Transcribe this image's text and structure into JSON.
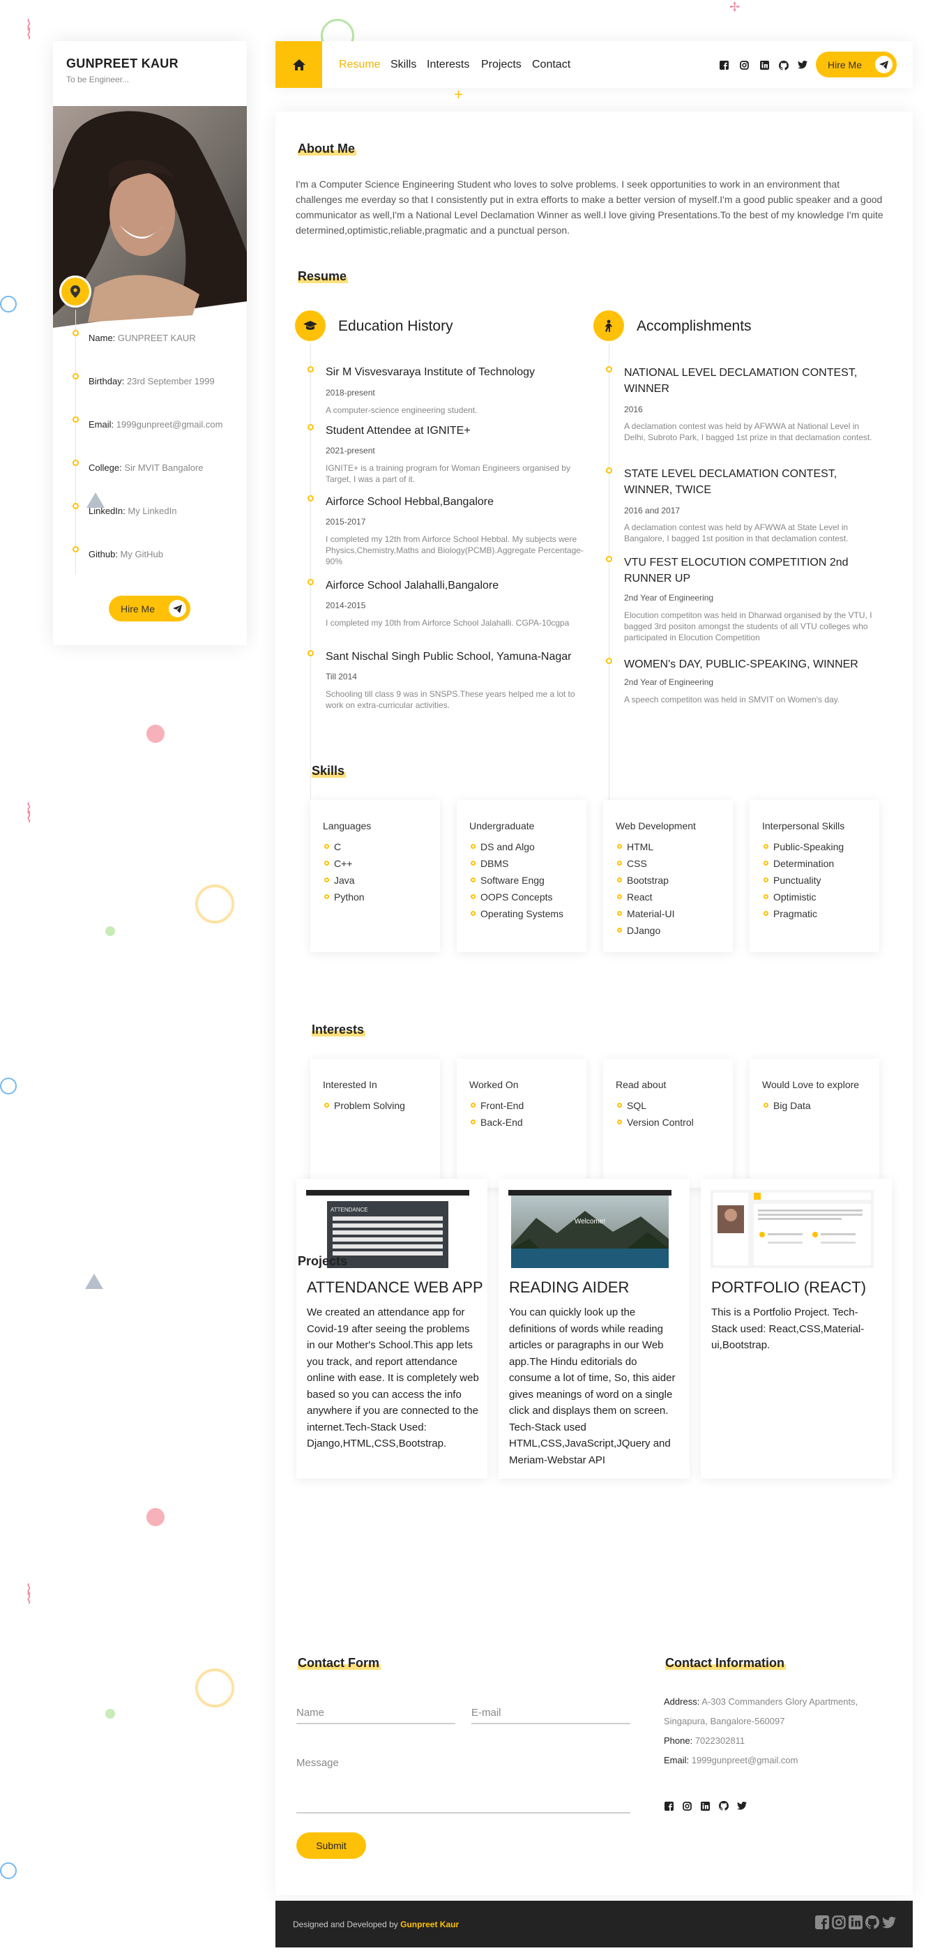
{
  "sidebar": {
    "name": "GUNPREET KAUR",
    "subtitle": "To be Engineer...",
    "items": [
      {
        "label": "Name:",
        "value": "GUNPREET KAUR"
      },
      {
        "label": "Birthday:",
        "value": "23rd September 1999"
      },
      {
        "label": "Email:",
        "value": "1999gunpreet@gmail.com"
      },
      {
        "label": "College:",
        "value": "Sir MVIT Bangalore"
      },
      {
        "label": "LinkedIn:",
        "value": "My LinkedIn"
      },
      {
        "label": "Github:",
        "value": "My GitHub"
      }
    ],
    "hire_label": "Hire Me"
  },
  "nav": {
    "links": [
      "Resume",
      "Skills",
      "Interests",
      "Projects",
      "Contact"
    ],
    "active": "Resume",
    "social_icons": [
      "facebook-icon",
      "instagram-icon",
      "linkedin-icon",
      "github-icon",
      "twitter-icon"
    ],
    "hire_label": "Hire Me"
  },
  "about": {
    "title": "About Me",
    "text": "I'm a Computer Science Engineering Student who loves to solve problems. I seek opportunities to work in an environment that challenges me everday so that I consistently put in extra efforts to make a better version of myself.I'm a good public speaker and a good communicator as well,I'm a National Level Declamation Winner as well.I love giving Presentations.To the best of my knowledge I'm quite determined,optimistic,reliable,pragmatic and a punctual person."
  },
  "resume": {
    "title": "Resume",
    "education": {
      "title": "Education History",
      "items": [
        {
          "title": "Sir M Visvesvaraya Institute of Technology",
          "date": "2018-present",
          "desc": "A computer-science engineering student."
        },
        {
          "title": "Student Attendee at IGNITE+",
          "date": "2021-present",
          "desc": "IGNITE+ is a training program for Woman Engineers organised by Target, I was a part of it."
        },
        {
          "title": "Airforce School Hebbal,Bangalore",
          "date": "2015-2017",
          "desc": "I completed my 12th from Airforce School Hebbal. My subjects were Physics,Chemistry,Maths and Biology(PCMB).Aggregate Percentage-90%"
        },
        {
          "title": "Airforce School Jalahalli,Bangalore",
          "date": "2014-2015",
          "desc": "I completed my 10th from Airforce School Jalahalli. CGPA-10cgpa"
        },
        {
          "title": "Sant Nischal Singh Public School, Yamuna-Nagar",
          "date": "Till 2014",
          "desc": "Schooling till class 9 was in SNSPS.These years helped me a lot to work on extra-curricular activities."
        }
      ]
    },
    "accomplishments": {
      "title": "Accomplishments",
      "items": [
        {
          "title": "NATIONAL LEVEL DECLAMATION CONTEST, WINNER",
          "date": "2016",
          "desc": "A declamation contest was held by AFWWA at National Level in Delhi, Subroto Park, I bagged 1st prize in that declamation contest."
        },
        {
          "title": "STATE LEVEL DECLAMATION CONTEST, WINNER, TWICE",
          "date": "2016 and 2017",
          "desc": "A declamation contest was held by AFWWA at State Level in Bangalore, I bagged 1st position in that declamation contest."
        },
        {
          "title": "VTU FEST ELOCUTION COMPETITION 2nd RUNNER UP",
          "date": "2nd Year of Engineering",
          "desc": "Elocution competiton was held in Dharwad organised by the VTU, I bagged 3rd positon amongst the students of all VTU colleges who participated in Elocution Competition"
        },
        {
          "title": "WOMEN's DAY, PUBLIC-SPEAKING, WINNER",
          "date": "2nd Year of Engineering",
          "desc": "A speech competiton was held in SMVIT on Women's day."
        }
      ]
    }
  },
  "skills": {
    "title": "Skills",
    "cards": [
      {
        "title": "Languages",
        "items": [
          "C",
          "C++",
          "Java",
          "Python"
        ]
      },
      {
        "title": "Undergraduate",
        "items": [
          "DS and Algo",
          "DBMS",
          "Software Engg",
          "OOPS Concepts",
          "Operating Systems"
        ]
      },
      {
        "title": "Web Development",
        "items": [
          "HTML",
          "CSS",
          "Bootstrap",
          "React",
          "Material-UI",
          "DJango"
        ]
      },
      {
        "title": "Interpersonal Skills",
        "items": [
          "Public-Speaking",
          "Determination",
          "Punctuality",
          "Optimistic",
          "Pragmatic"
        ]
      }
    ]
  },
  "interests": {
    "title": "Interests",
    "cards": [
      {
        "title": "Interested In",
        "items": [
          "Problem Solving"
        ]
      },
      {
        "title": "Worked On",
        "items": [
          "Front-End",
          "Back-End"
        ]
      },
      {
        "title": "Read about",
        "items": [
          "SQL",
          "Version Control"
        ]
      },
      {
        "title": "Would Love to explore",
        "items": [
          "Big Data"
        ]
      }
    ]
  },
  "projects": {
    "title": "Projects",
    "items": [
      {
        "title": "ATTENDANCE WEB APP",
        "desc": "We created an attendance app for Covid-19 after seeing the problems in our Mother's School.This app lets you track, and report attendance online with ease. It is completely web based so you can access the info anywhere if you are connected to the internet.Tech-Stack Used: Django,HTML,CSS,Bootstrap.",
        "thumb_caption": "ATTENDANCE"
      },
      {
        "title": "READING AIDER",
        "desc": "You can quickly look up the definitions of words while reading articles or paragraphs in our Web app.The Hindu editorials do consume a lot of time, So, this aider gives meanings of word on a single click and displays them on screen. Tech-Stack used HTML,CSS,JavaScript,JQuery and Meriam-Webstar API",
        "thumb_caption": "Welcome!"
      },
      {
        "title": "PORTFOLIO (REACT)",
        "desc": "This is a Portfolio Project. Tech-Stack used: React,CSS,Material-ui,Bootstrap.",
        "thumb_caption": ""
      }
    ]
  },
  "contact": {
    "form_title": "Contact Form",
    "name_placeholder": "Name",
    "email_placeholder": "E-mail",
    "message_placeholder": "Message",
    "submit_label": "Submit",
    "info_title": "Contact Information",
    "address_label": "Address:",
    "address_value": "A-303 Commanders Glory Apartments, Singapura, Bangalore-560097",
    "phone_label": "Phone:",
    "phone_value": "7022302811",
    "email_label": "Email:",
    "email_value": "1999gunpreet@gmail.com",
    "social_icons": [
      "facebook-icon",
      "instagram-icon",
      "linkedin-icon",
      "github-icon",
      "twitter-icon"
    ]
  },
  "footer": {
    "text": "Designed and Developed by",
    "author": "Gunpreet Kaur",
    "social_icons": [
      "facebook-icon",
      "instagram-icon",
      "linkedin-icon",
      "github-icon",
      "twitter-icon"
    ]
  },
  "colors": {
    "accent": "#ffc107",
    "footer_bg": "#232323"
  }
}
